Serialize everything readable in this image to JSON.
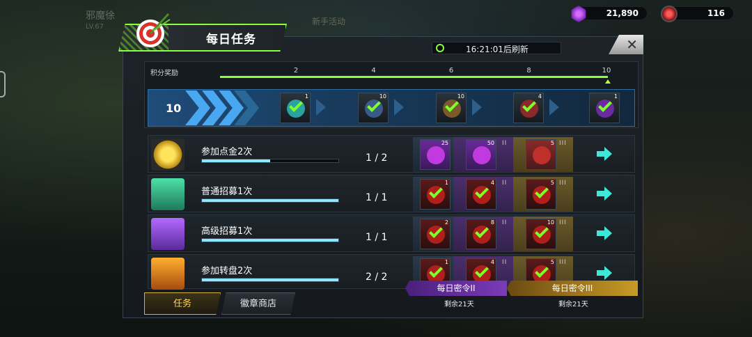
{
  "background": {
    "player_name": "邪魔徐",
    "level": "LV.67",
    "event": "新手活动"
  },
  "currency": [
    {
      "icon": "purple-gem-icon",
      "value": "21,890"
    },
    {
      "icon": "red-token-icon",
      "value": "116"
    }
  ],
  "panel": {
    "title": "每日任务",
    "close": "✕",
    "refresh_timer": "16:21:01后刷新"
  },
  "points": {
    "label": "积分奖励",
    "ticks": [
      "2",
      "4",
      "6",
      "8",
      "10"
    ],
    "current": "10",
    "progress_fraction": 1.0,
    "rewards": [
      {
        "count": "1",
        "claimed": true
      },
      {
        "count": "10",
        "claimed": true
      },
      {
        "count": "10",
        "claimed": true
      },
      {
        "count": "4",
        "claimed": true
      },
      {
        "count": "1",
        "claimed": true
      }
    ]
  },
  "tasks": [
    {
      "name": "参加点金2次",
      "progress": "1 / 2",
      "fraction": 0.5,
      "icon": "gold-coin-icon",
      "rewards": [
        {
          "count": "25",
          "claimed": false
        },
        {
          "count": "50",
          "claimed": false
        },
        {
          "count": "5",
          "claimed": false
        }
      ]
    },
    {
      "name": "普通招募1次",
      "progress": "1 / 1",
      "fraction": 1.0,
      "icon": "green-chest-icon",
      "rewards": [
        {
          "count": "1",
          "claimed": true
        },
        {
          "count": "4",
          "claimed": true
        },
        {
          "count": "5",
          "claimed": true
        }
      ]
    },
    {
      "name": "高级招募1次",
      "progress": "1 / 1",
      "fraction": 1.0,
      "icon": "purple-chest-icon",
      "rewards": [
        {
          "count": "2",
          "claimed": true
        },
        {
          "count": "8",
          "claimed": true
        },
        {
          "count": "10",
          "claimed": true
        }
      ]
    },
    {
      "name": "参加转盘2次",
      "progress": "2 / 2",
      "fraction": 1.0,
      "icon": "slot-777-icon",
      "rewards": [
        {
          "count": "1",
          "claimed": true
        },
        {
          "count": "4",
          "claimed": true
        },
        {
          "count": "5",
          "claimed": true
        }
      ]
    }
  ],
  "slot_marks": {
    "s2": "II",
    "s3": "III"
  },
  "tabs": {
    "tasks": "任务",
    "shop": "徽章商店"
  },
  "passes": [
    {
      "name": "每日密令II",
      "remaining": "剩余21天"
    },
    {
      "name": "每日密令III",
      "remaining": "剩余21天"
    }
  ]
}
